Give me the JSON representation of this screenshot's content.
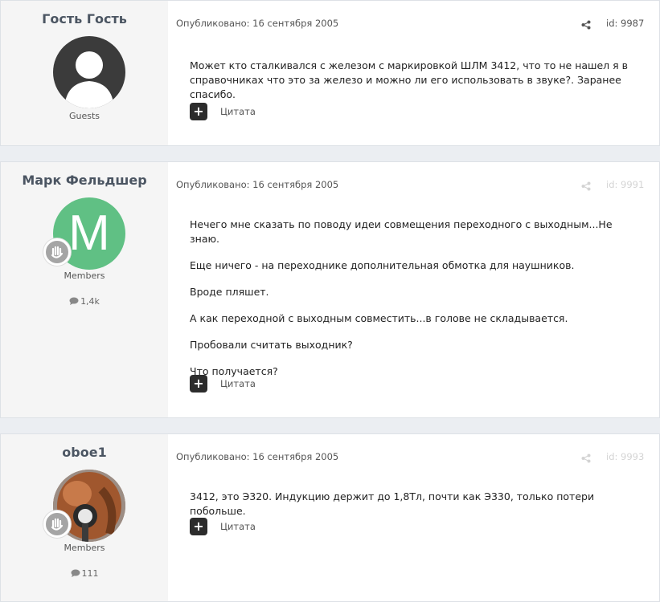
{
  "posts": [
    {
      "author": "Гость Гость",
      "avatar": "default-person",
      "group": "Guests",
      "published": "Опубликовано: 16 сентября 2005",
      "id_label": "id: 9987",
      "paragraphs": [
        "Может кто сталкивался с железом с маркировкой ШЛМ 3412, что то не нашел я в справочниках что это за железо и можно ли его использовать в звуке?. Заранее спасибо."
      ],
      "quote_label": "Цитата"
    },
    {
      "author": "Марк Фельдшер",
      "avatar_letter": "M",
      "avatar_color": "#60c084",
      "group": "Members",
      "post_count": "1,4k",
      "published": "Опубликовано: 16 сентября 2005",
      "id_label": "id: 9991",
      "paragraphs": [
        "Нечего мне сказать по поводу идеи совмещения переходного с выходным...Не знаю.",
        "Еще ничего - на переходнике дополнительная обмотка для наушников.",
        "Вроде пляшет.",
        "А как переходной с выходным совместить...в голове не складывается.",
        "Пробовали считать выходник?",
        "Что получается?"
      ],
      "quote_label": "Цитата"
    },
    {
      "author": "oboe1",
      "avatar": "photo",
      "group": "Members",
      "post_count": "111",
      "published": "Опубликовано: 16 сентября 2005",
      "id_label": "id: 9993",
      "paragraphs": [
        "3412, это Э320. Индукцию держит до 1,8Тл, почти как Э330, только потери побольше."
      ],
      "quote_label": "Цитата"
    }
  ]
}
